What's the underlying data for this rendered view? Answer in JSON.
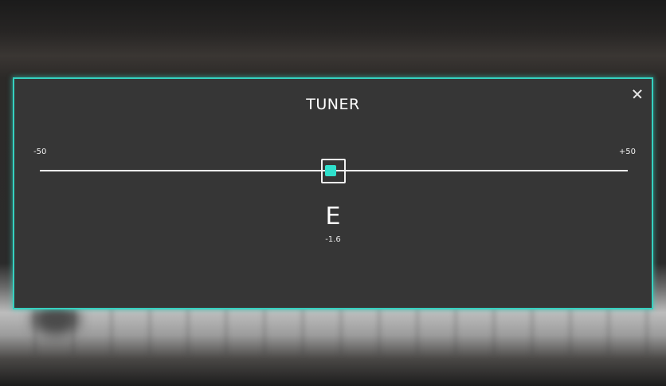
{
  "tuner": {
    "title": "TUNER",
    "close_icon": "close-icon",
    "scale": {
      "min_label": "-50",
      "max_label": "+50",
      "min": -50,
      "max": 50
    },
    "note": "E",
    "cents_label": "-1.6",
    "cents_value": -1.6
  },
  "colors": {
    "accent": "#35d1c0",
    "needle": "#2fe0cc",
    "panel": "#363636",
    "text": "#ffffff"
  }
}
